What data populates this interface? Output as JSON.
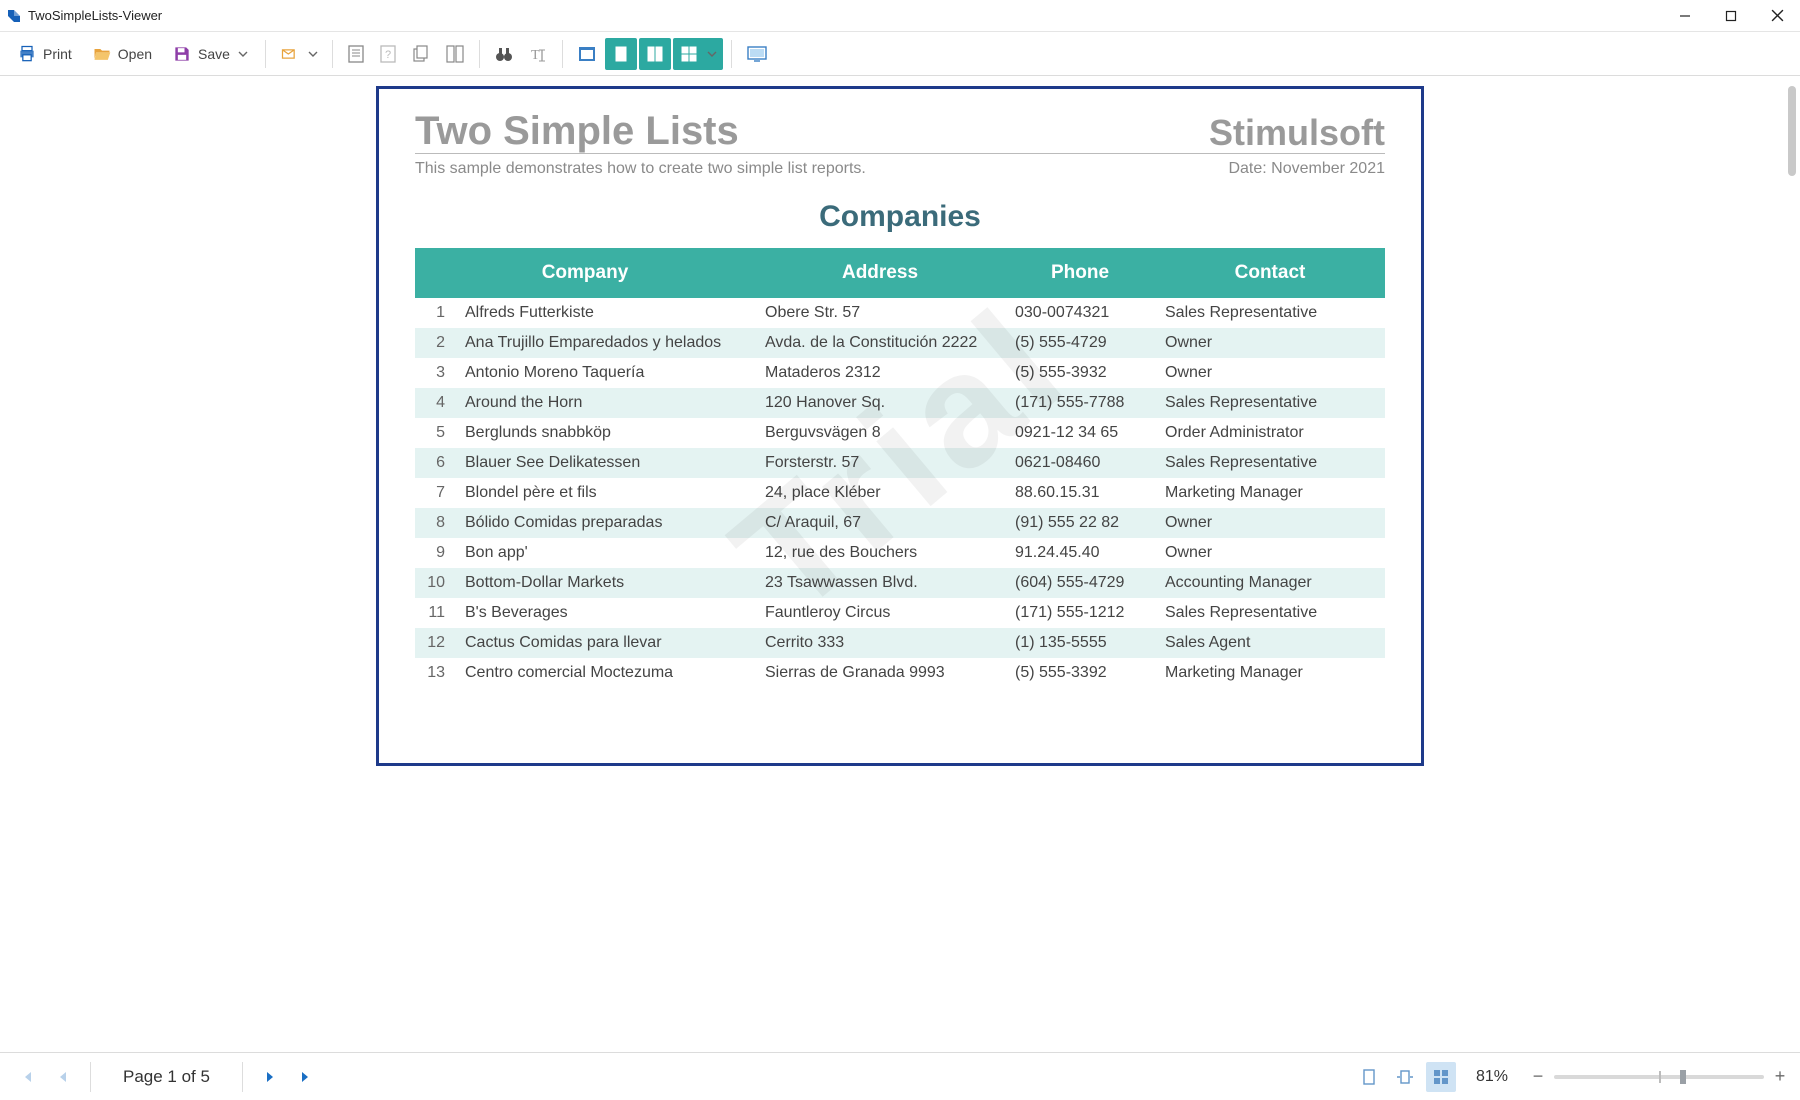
{
  "window": {
    "title": "TwoSimpleLists-Viewer"
  },
  "toolbar": {
    "print": "Print",
    "open": "Open",
    "save": "Save"
  },
  "report": {
    "title": "Two Simple Lists",
    "brand": "Stimulsoft",
    "subtitle": "This sample demonstrates how to create two simple list reports.",
    "date": "Date: November 2021",
    "section": "Companies",
    "columns": {
      "c1": "Company",
      "c2": "Address",
      "c3": "Phone",
      "c4": "Contact"
    },
    "rows": [
      {
        "n": "1",
        "company": "Alfreds Futterkiste",
        "address": "Obere Str. 57",
        "phone": "030-0074321",
        "contact": "Sales Representative"
      },
      {
        "n": "2",
        "company": "Ana Trujillo Emparedados y helados",
        "address": "Avda. de la Constitución 2222",
        "phone": "(5) 555-4729",
        "contact": "Owner"
      },
      {
        "n": "3",
        "company": "Antonio Moreno Taquería",
        "address": "Mataderos  2312",
        "phone": "(5) 555-3932",
        "contact": "Owner"
      },
      {
        "n": "4",
        "company": "Around the Horn",
        "address": "120 Hanover Sq.",
        "phone": "(171) 555-7788",
        "contact": "Sales Representative"
      },
      {
        "n": "5",
        "company": "Berglunds snabbköp",
        "address": "Berguvsvägen  8",
        "phone": "0921-12 34 65",
        "contact": "Order Administrator"
      },
      {
        "n": "6",
        "company": "Blauer See Delikatessen",
        "address": "Forsterstr. 57",
        "phone": "0621-08460",
        "contact": "Sales Representative"
      },
      {
        "n": "7",
        "company": "Blondel père et fils",
        "address": "24, place Kléber",
        "phone": "88.60.15.31",
        "contact": "Marketing Manager"
      },
      {
        "n": "8",
        "company": "Bólido Comidas preparadas",
        "address": "C/ Araquil, 67",
        "phone": "(91) 555 22 82",
        "contact": "Owner"
      },
      {
        "n": "9",
        "company": "Bon app'",
        "address": "12, rue des Bouchers",
        "phone": "91.24.45.40",
        "contact": "Owner"
      },
      {
        "n": "10",
        "company": "Bottom-Dollar Markets",
        "address": "23 Tsawwassen Blvd.",
        "phone": "(604) 555-4729",
        "contact": "Accounting Manager"
      },
      {
        "n": "11",
        "company": "B's Beverages",
        "address": "Fauntleroy Circus",
        "phone": "(171) 555-1212",
        "contact": "Sales Representative"
      },
      {
        "n": "12",
        "company": "Cactus Comidas para llevar",
        "address": "Cerrito 333",
        "phone": "(1) 135-5555",
        "contact": "Sales Agent"
      },
      {
        "n": "13",
        "company": "Centro comercial Moctezuma",
        "address": "Sierras de Granada 9993",
        "phone": "(5) 555-3392",
        "contact": "Marketing Manager"
      }
    ]
  },
  "pager": {
    "label": "Page 1 of 5",
    "zoom": "81%"
  }
}
